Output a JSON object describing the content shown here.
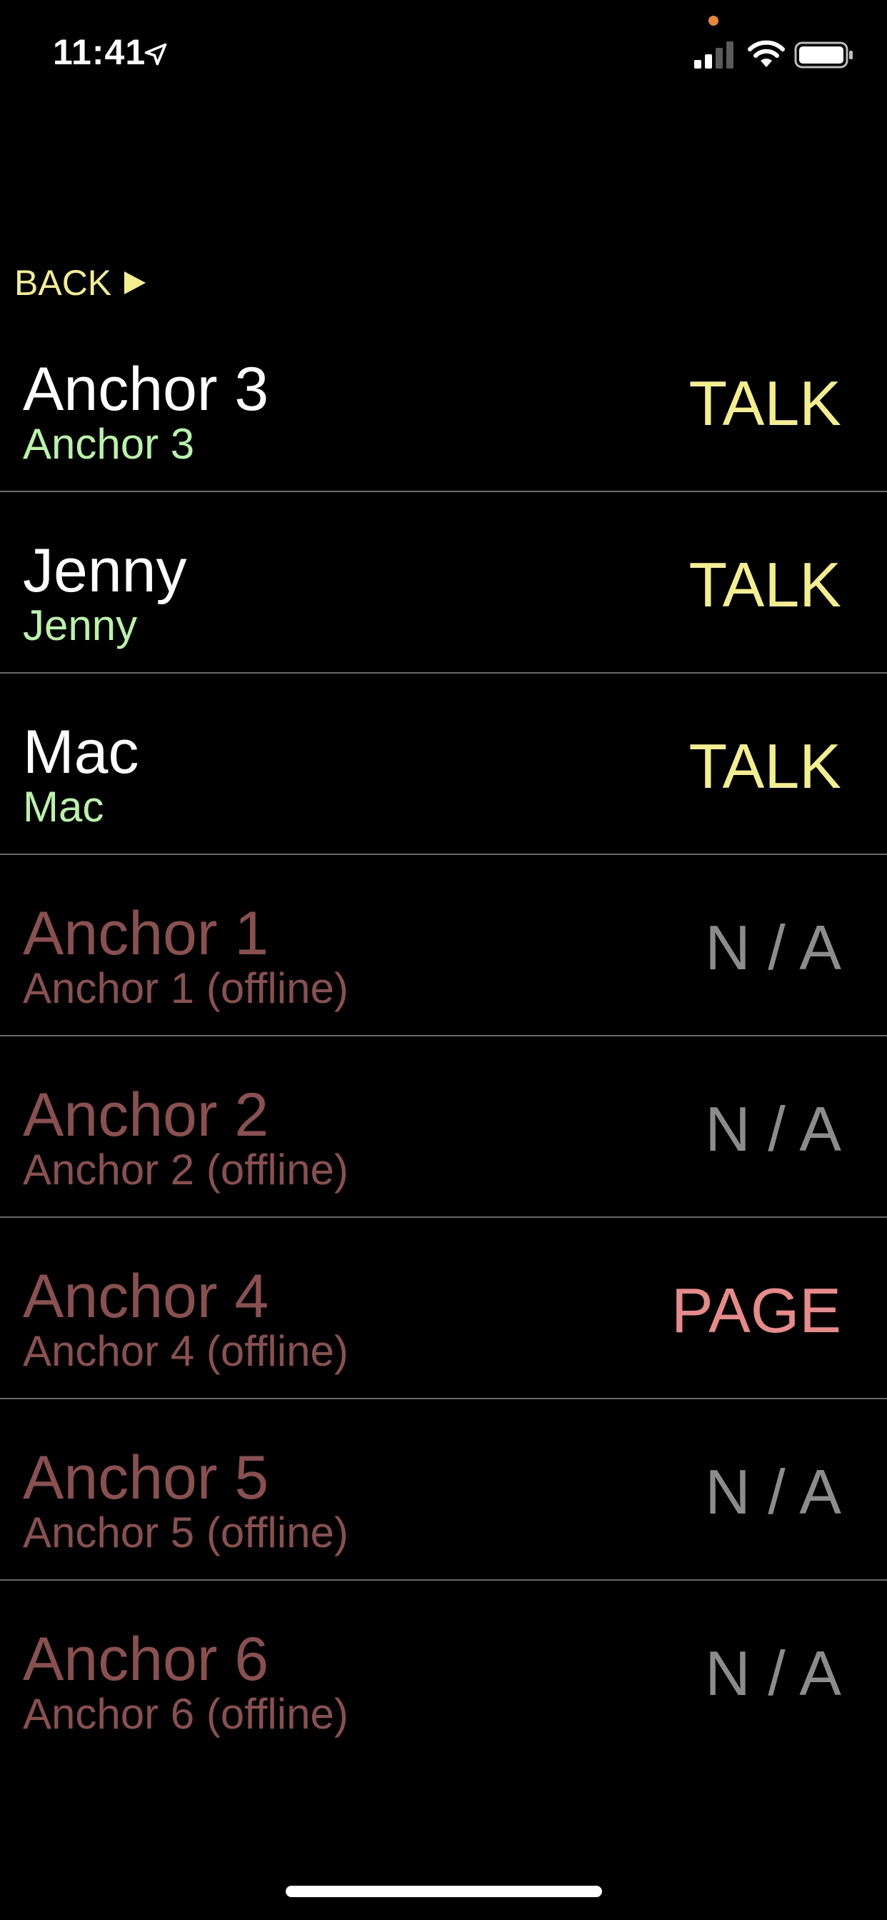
{
  "status_bar": {
    "time": "11:41",
    "icons": [
      "location-arrow-icon",
      "signal-icon",
      "wifi-icon",
      "battery-icon"
    ],
    "privacy_dot_color": "#e8873a"
  },
  "header": {
    "back_label": "BACK",
    "back_color": "#f4ee8f"
  },
  "colors": {
    "online_name": "#ffffff",
    "online_sub": "#b9f2a9",
    "offline_name": "#8a4f4f",
    "offline_sub": "#8a4f4f",
    "talk": "#f4ee8f",
    "na": "#8c8c8c",
    "page": "#e88a8a"
  },
  "contacts": [
    {
      "name": "Anchor 3",
      "status": "Anchor 3",
      "action": "TALK",
      "online": true
    },
    {
      "name": "Jenny",
      "status": "Jenny",
      "action": "TALK",
      "online": true
    },
    {
      "name": "Mac",
      "status": "Mac",
      "action": "TALK",
      "online": true
    },
    {
      "name": "Anchor 1",
      "status": "Anchor 1 (offline)",
      "action": "N / A",
      "online": false
    },
    {
      "name": "Anchor 2",
      "status": "Anchor 2 (offline)",
      "action": "N / A",
      "online": false
    },
    {
      "name": "Anchor 4",
      "status": "Anchor 4 (offline)",
      "action": "PAGE",
      "online": false
    },
    {
      "name": "Anchor 5",
      "status": "Anchor 5 (offline)",
      "action": "N / A",
      "online": false
    },
    {
      "name": "Anchor 6",
      "status": "Anchor 6 (offline)",
      "action": "N / A",
      "online": false
    }
  ]
}
